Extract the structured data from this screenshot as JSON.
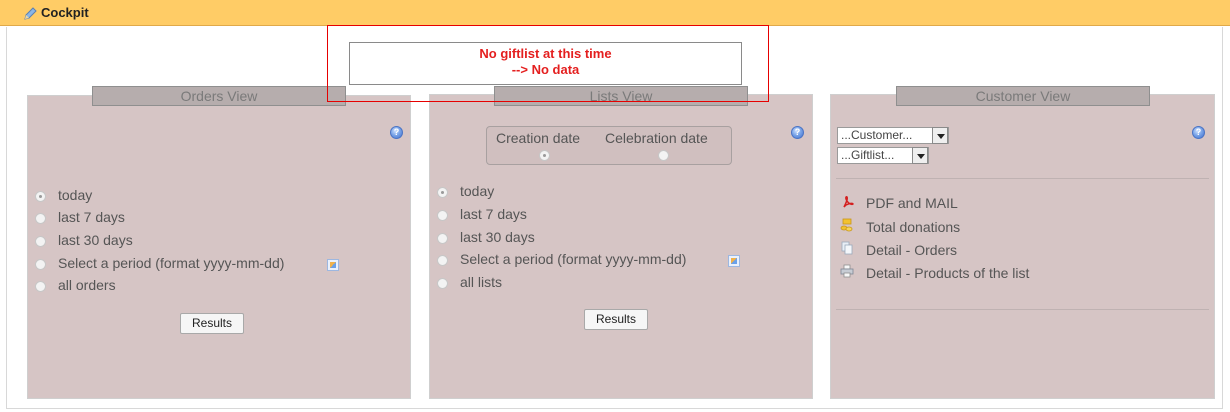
{
  "header": {
    "title": "Cockpit",
    "icon": "pencil-icon"
  },
  "message": {
    "line1": "No giftlist at this time",
    "line2": "--> No data"
  },
  "orders_view": {
    "title": "Orders View",
    "options": [
      {
        "label": "today",
        "selected": true
      },
      {
        "label": "last 7 days",
        "selected": false
      },
      {
        "label": "last 30 days",
        "selected": false
      },
      {
        "label": "Select a period (format yyyy-mm-dd)",
        "selected": false
      },
      {
        "label": "all orders",
        "selected": false
      }
    ],
    "results_label": "Results"
  },
  "lists_view": {
    "title": "Lists View",
    "date_type": {
      "creation_label": "Creation date",
      "celebration_label": "Celebration date",
      "selected": "creation"
    },
    "options": [
      {
        "label": "today",
        "selected": true
      },
      {
        "label": "last 7 days",
        "selected": false
      },
      {
        "label": "last 30 days",
        "selected": false
      },
      {
        "label": "Select a period (format yyyy-mm-dd)",
        "selected": false
      },
      {
        "label": "all lists",
        "selected": false
      }
    ],
    "results_label": "Results"
  },
  "customer_view": {
    "title": "Customer View",
    "customer_select": "...Customer...",
    "giftlist_select": "...Giftlist...",
    "links": [
      {
        "label": "PDF and MAIL",
        "icon": "pdf-icon"
      },
      {
        "label": "Total donations",
        "icon": "coins-icon"
      },
      {
        "label": "Detail - Orders",
        "icon": "documents-icon"
      },
      {
        "label": "Detail - Products of the list",
        "icon": "printer-icon"
      }
    ]
  },
  "colors": {
    "header": "#ffcc66",
    "panel": "#d6c5c5",
    "message": "#e41f1f"
  }
}
